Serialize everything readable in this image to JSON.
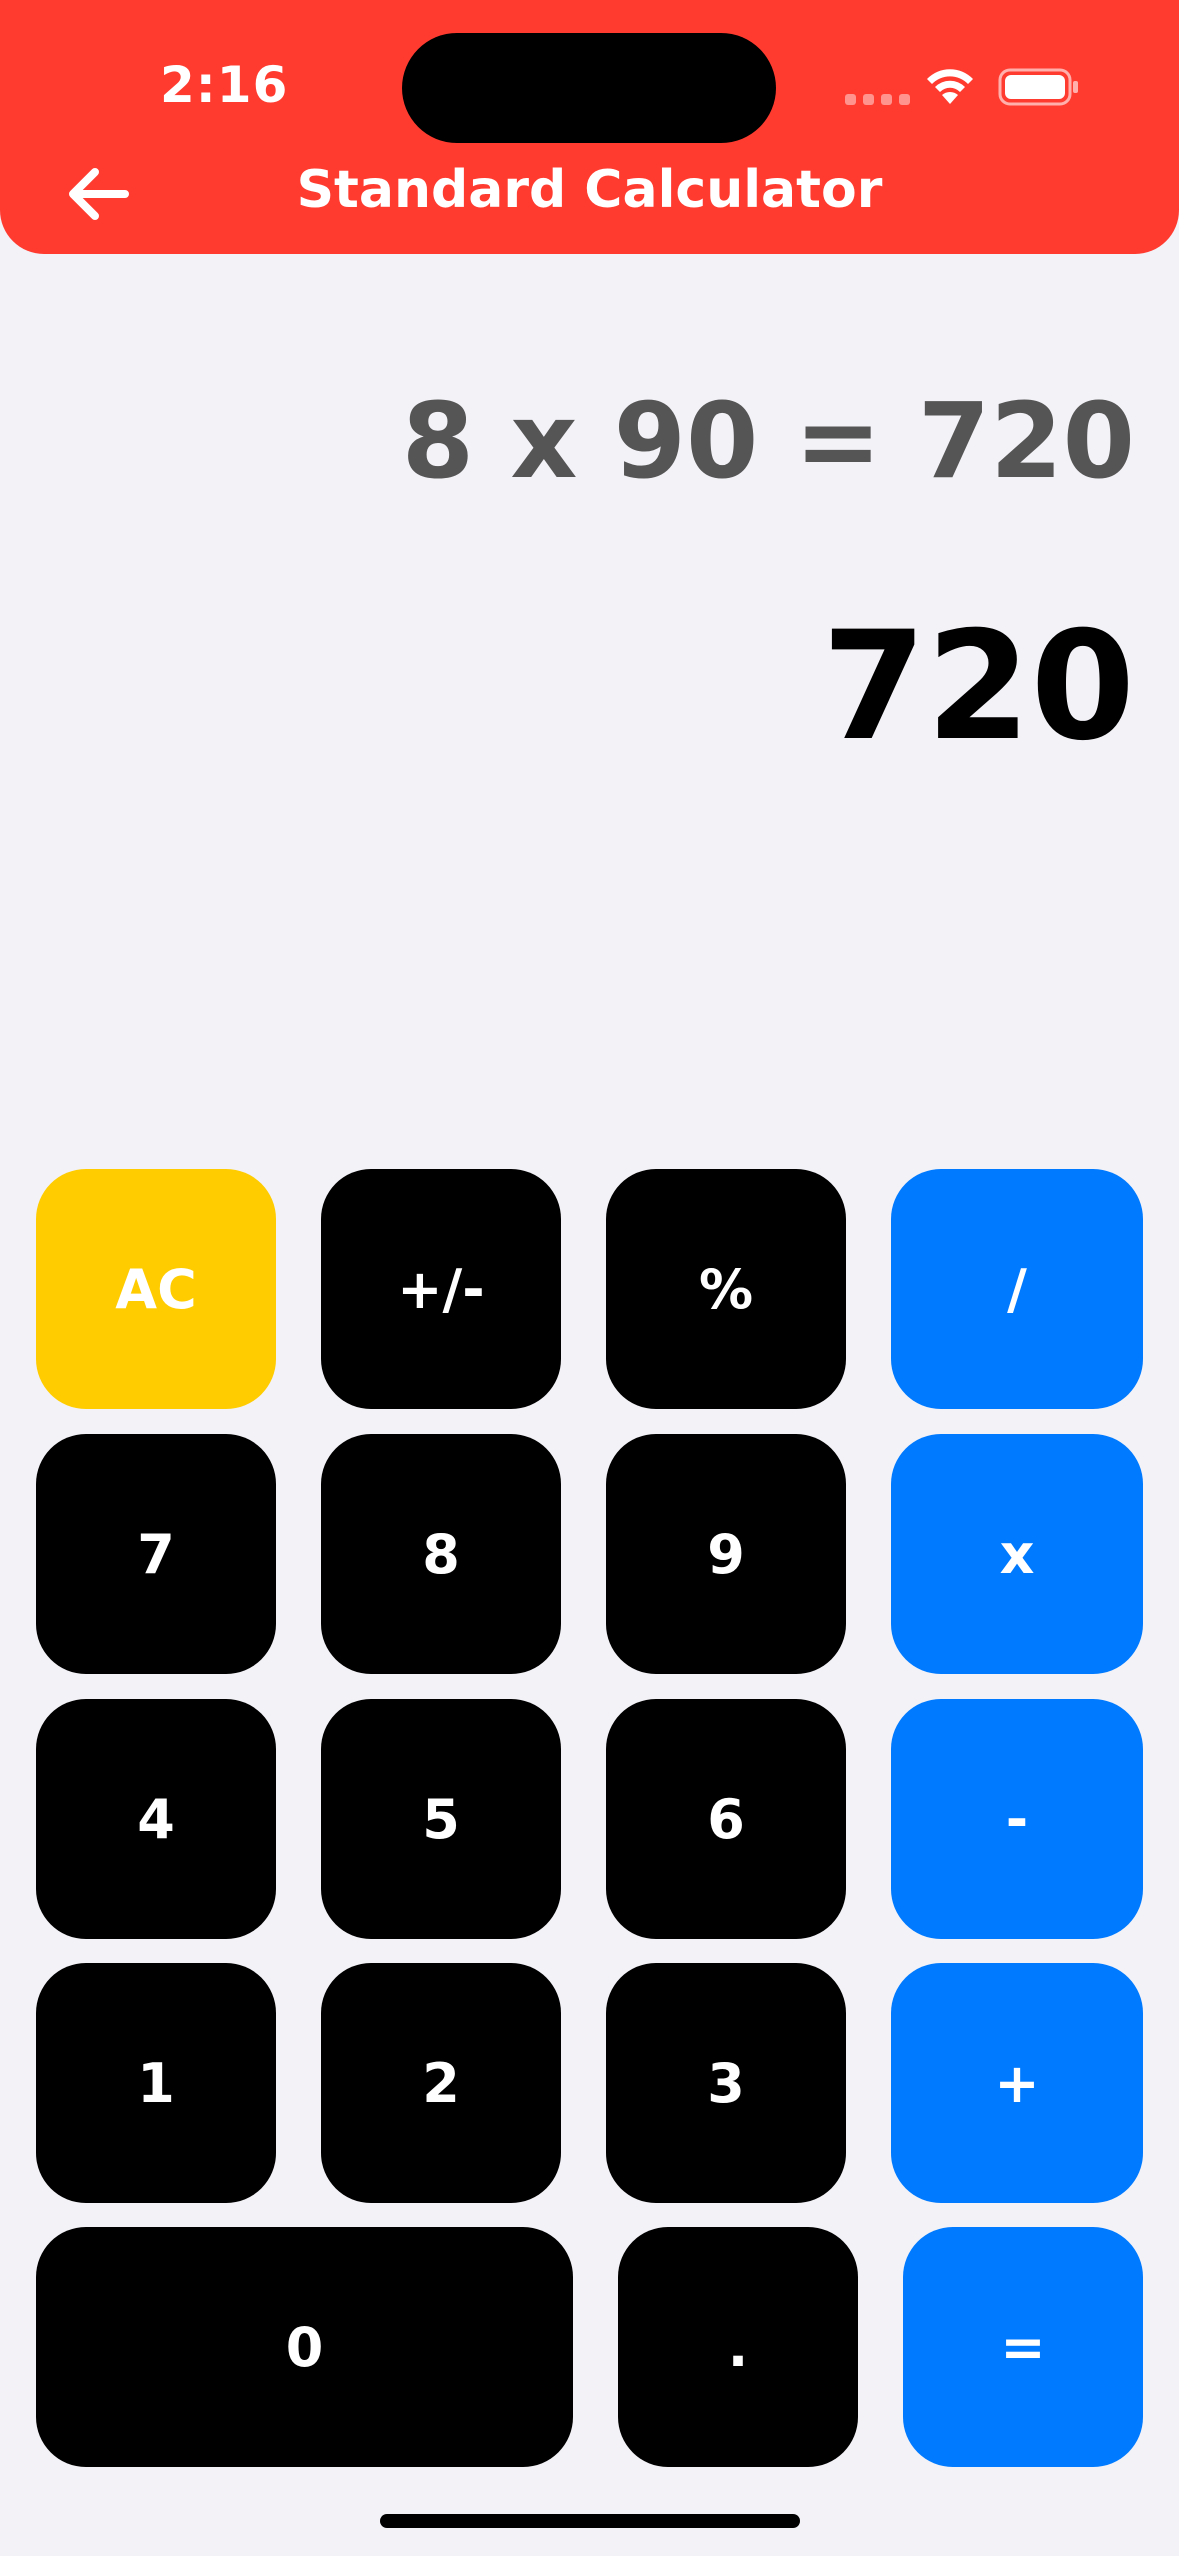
{
  "status_bar": {
    "time": "2:16"
  },
  "header": {
    "title": "Standard Calculator",
    "color": "#ff3b30",
    "back_icon": "arrow-left-icon"
  },
  "display": {
    "expression": "8 x 90 = 720",
    "result": "720"
  },
  "keypad": {
    "ac": "AC",
    "plus_minus": "+/-",
    "percent": "%",
    "divide": "/",
    "seven": "7",
    "eight": "8",
    "nine": "9",
    "multiply": "x",
    "four": "4",
    "five": "5",
    "six": "6",
    "minus": "-",
    "one": "1",
    "two": "2",
    "three": "3",
    "plus": "+",
    "zero": "0",
    "decimal": ".",
    "equals": "="
  },
  "colors": {
    "number_key": "#000000",
    "operator_key": "#007aff",
    "clear_key": "#ffcc00",
    "background": "#f2f2f7"
  }
}
